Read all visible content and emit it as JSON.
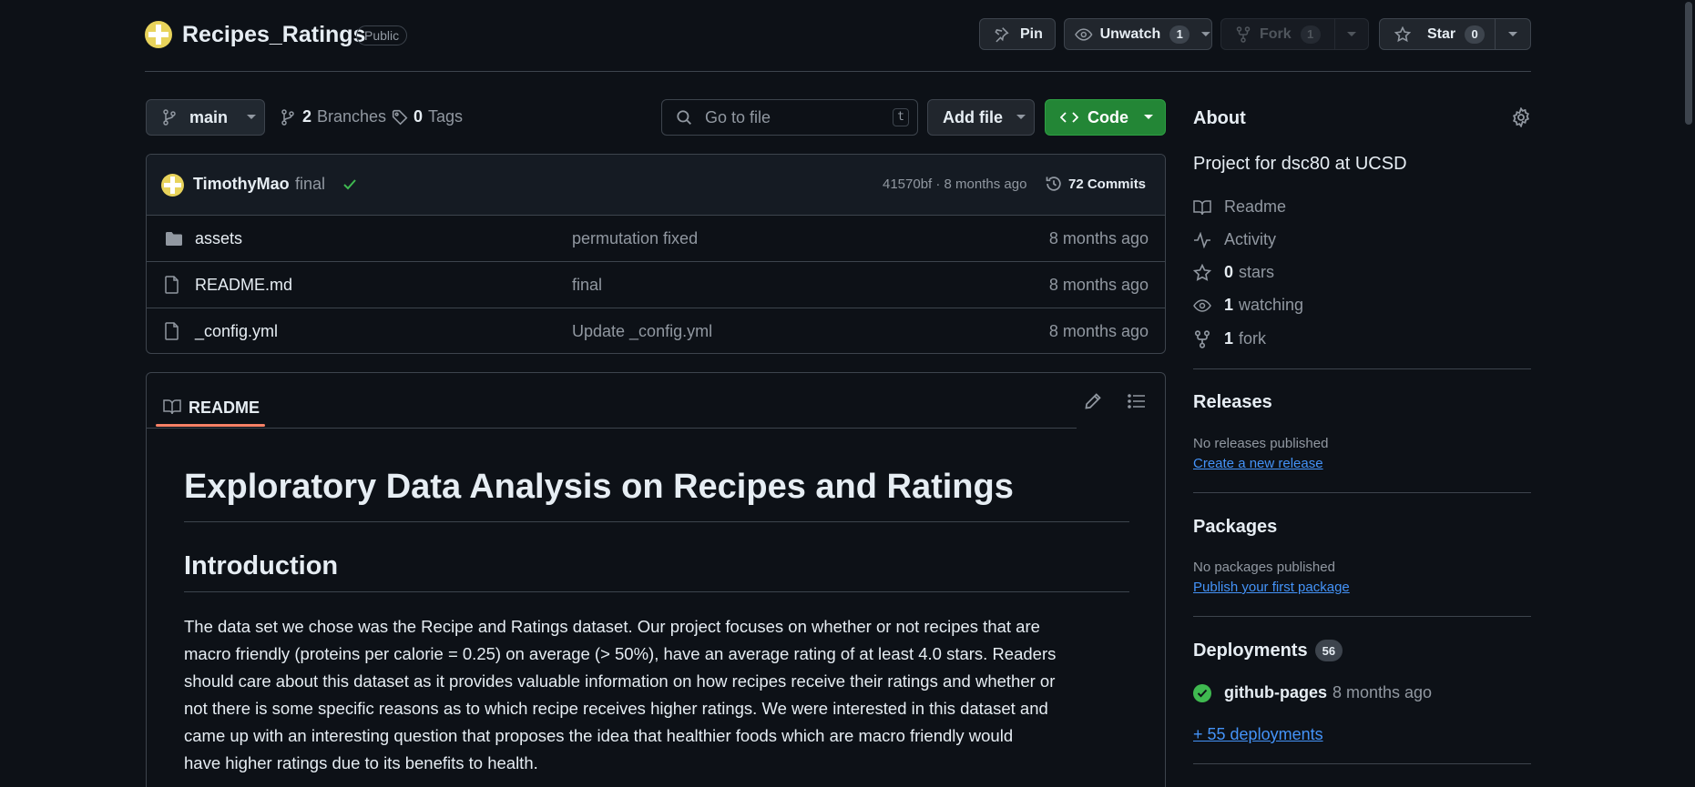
{
  "repo": {
    "name": "Recipes_Ratings",
    "visibility": "Public"
  },
  "actions": {
    "pin": "Pin",
    "unwatch": "Unwatch",
    "watch_count": "1",
    "fork": "Fork",
    "fork_count": "1",
    "star": "Star",
    "star_count": "0"
  },
  "toolbar": {
    "branch": "main",
    "branches_count": "2",
    "branches_label": "Branches",
    "tags_count": "0",
    "tags_label": "Tags",
    "search_placeholder": "Go to file",
    "search_shortcut": "t",
    "add_file": "Add file",
    "code": "Code"
  },
  "commit": {
    "author": "TimothyMao",
    "message": "final",
    "meta": "41570bf · 8 months ago",
    "commits_count": "72 Commits"
  },
  "files": [
    {
      "name": "assets",
      "type": "folder",
      "message": "permutation fixed",
      "date": "8 months ago"
    },
    {
      "name": "README.md",
      "type": "file",
      "message": "final",
      "date": "8 months ago"
    },
    {
      "name": "_config.yml",
      "type": "file",
      "message": "Update _config.yml",
      "date": "8 months ago"
    }
  ],
  "readme": {
    "tab_label": "README",
    "h1": "Exploratory Data Analysis on Recipes and Ratings",
    "h2": "Introduction",
    "paragraph_lines": [
      "The data set we chose was the Recipe and Ratings dataset. Our project focuses on whether or not recipes that are",
      "macro friendly (proteins per calorie = 0.25) on average (> 50%), have an average rating of at least 4.0 stars. Readers",
      "should care about this dataset as it provides valuable information on how recipes receive their ratings and whether or",
      "not there is some specific reasons as to which recipe receives higher ratings. We were interested in this dataset and",
      "came up with an interesting question that proposes the idea that healthier foods which are macro friendly would",
      "have higher ratings due to its benefits to health."
    ]
  },
  "about": {
    "title": "About",
    "description": "Project for dsc80 at UCSD",
    "readme": "Readme",
    "activity": "Activity",
    "stars_count": "0",
    "stars_label": "stars",
    "watching_count": "1",
    "watching_label": "watching",
    "fork_count": "1",
    "fork_label": "fork"
  },
  "releases": {
    "title": "Releases",
    "empty": "No releases published",
    "link": "Create a new release"
  },
  "packages": {
    "title": "Packages",
    "empty": "No packages published",
    "link": "Publish your first package"
  },
  "deployments": {
    "title": "Deployments",
    "count": "56",
    "env": "github-pages",
    "env_time": "8 months ago",
    "more": "+ 55 deployments"
  },
  "colors": {
    "background": "#0d1117",
    "border": "#3d444d",
    "accent_green": "#238636",
    "link_blue": "#4493f8",
    "tab_underline": "#f78166",
    "success": "#3fb950"
  }
}
